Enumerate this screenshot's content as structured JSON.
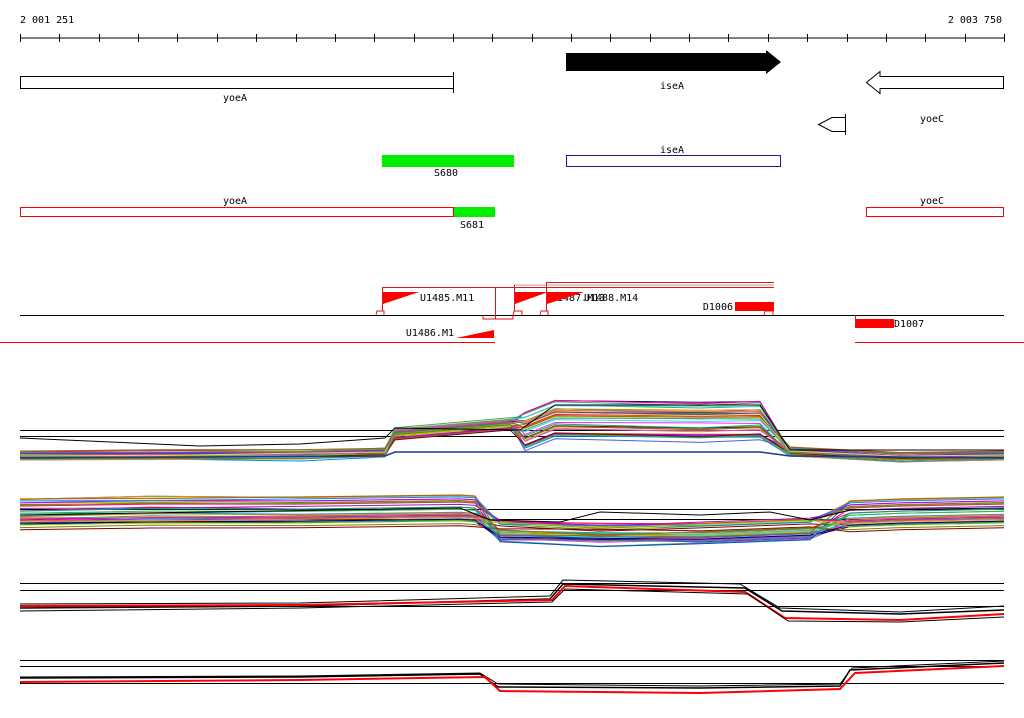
{
  "ruler": {
    "start_label": "2 001 251",
    "end_label": "2 003 750"
  },
  "genes": {
    "yoeA_top": "yoeA",
    "iseA_top": "iseA",
    "yoeC_top": "yoeC",
    "iseA_mid": "iseA",
    "yoeA_bottom": "yoeA",
    "yoeC_bottom": "yoeC"
  },
  "segments": {
    "s680": "S680",
    "s681": "S681"
  },
  "features": {
    "u1485": "U1485.M11",
    "u1487": "U1487.M13",
    "u1488": "U1488.M14",
    "d1006": "D1006",
    "u1486": "U1486.M1",
    "d1007": "D1007"
  },
  "colors": {
    "green": "#00ee00",
    "red": "#ff0000",
    "blue": "#1a1aa0",
    "black": "#000000"
  }
}
